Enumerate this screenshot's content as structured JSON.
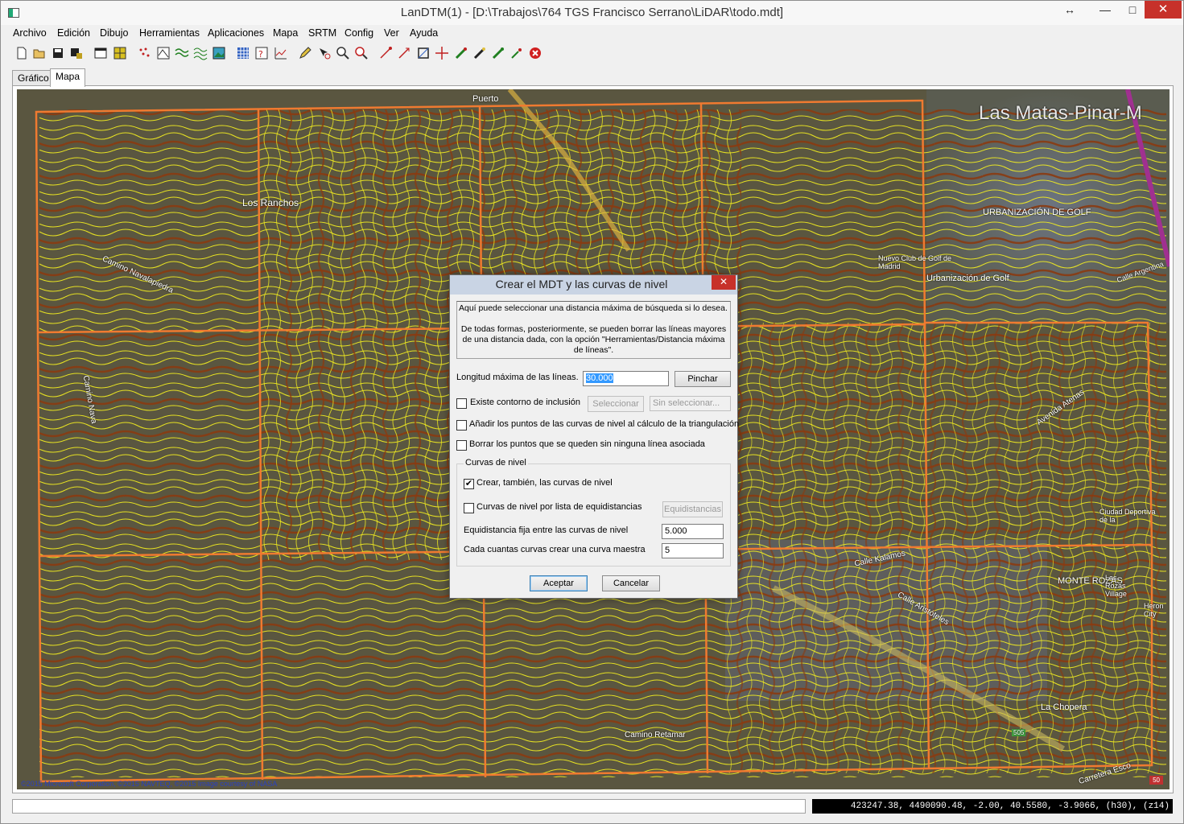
{
  "window": {
    "title": "LanDTM(1) - [D:\\Trabajos\\764 TGS Francisco Serrano\\LiDAR\\todo.mdt]",
    "restore_glyph": "↔",
    "minimize_glyph": "—",
    "maximize_glyph": "□",
    "close_glyph": "✕"
  },
  "menu": [
    "Archivo",
    "Edición",
    "Dibujo",
    "Herramientas",
    "Aplicaciones",
    "Mapa",
    "SRTM",
    "Config",
    "Ver",
    "Ayuda"
  ],
  "toolbar_icons": [
    "new-file-icon",
    "open-folder-icon",
    "save-icon",
    "save-as-icon",
    "window-icon",
    "grid-pattern-icon",
    "scatter-icon",
    "map-tile-icon",
    "contour-icon",
    "contour-alt-icon",
    "image-icon",
    "table-grid-icon",
    "help-grid-icon",
    "profile-icon",
    "pencil-icon",
    "select-icon",
    "zoom-in-icon",
    "zoom-out-icon",
    "arrow-icon",
    "arrow-alt-icon",
    "crop-icon",
    "crosshair-icon",
    "brush-icon",
    "brush-alt-icon",
    "paint-icon",
    "picker-icon",
    "stop-icon"
  ],
  "tabs": [
    "Gráfico",
    "Mapa"
  ],
  "active_tab": "Mapa",
  "map": {
    "labels": {
      "las_matas": "Las Matas-Pinar-M",
      "urbanizacion_golf": "URBANIZACIÓN DE GOLF",
      "nuevo_club": "Nuevo Club de Golf de Madrid",
      "urbanizacion_golf2": "Urbanización de Golf",
      "calle_argentina": "Calle Argentina",
      "los_ranchos": "Los Ranchos",
      "camino_navalapiedra": "Camino Navalapiedra",
      "camino_nava": "Camino Nava",
      "avenida_atenas": "Avenida Atenas",
      "calle_kalamos": "Calle Kalamos",
      "calle_aristoteles": "Calle Aristóteles",
      "monte_rozas": "MONTE ROZAS",
      "las_rozas_village": "Las Rozas Village",
      "ciudad_deportiva": "Ciudad Deportiva de la",
      "camino_retamar": "Camino Retamar",
      "puerto": "Puerto",
      "la_chopera": "La Chopera",
      "road_505": "505",
      "heron_city": "Heron City",
      "carretera": "Carretera Esco"
    },
    "copyright": "©2015 Microsoft Corporation, ©2015 NAVTEQ, ©2015 Image courtesy of NASA",
    "scale_badge": "50"
  },
  "status": {
    "left_text": "",
    "coordinates": "423247.38, 4490090.48, -2.00, 40.5580, -3.9066, (h30), (z14)"
  },
  "dialog": {
    "title": "Crear el MDT y las curvas de nivel",
    "close_glyph": "✕",
    "info_line1": "Aquí puede seleccionar una distancia máxima de búsqueda si lo desea.",
    "info_line2": "De todas formas, posteriormente, se pueden borrar las líneas mayores de una distancia dada, con la opción \"Herramientas/Distancia máxima de líneas\".",
    "max_length_label": "Longitud máxima de las líneas.",
    "max_length_value": "30.000",
    "pinchar_button": "Pinchar",
    "contorno_label": "Existe contorno de inclusión",
    "contorno_checked": false,
    "seleccionar_button": "Seleccionar",
    "sin_seleccionar": "Sin seleccionar...",
    "anadir_label": "Añadir los puntos de las curvas de nivel al cálculo de la triangulación",
    "anadir_checked": false,
    "borrar_label": "Borrar los puntos que se queden sin ninguna línea asociada",
    "borrar_checked": false,
    "group_label": "Curvas de nivel",
    "crear_label": "Crear, también, las curvas de nivel",
    "crear_checked": true,
    "lista_label": "Curvas de nivel por lista de equidistancias",
    "lista_checked": false,
    "equidistancias_button": "Equidistancias",
    "equidistancia_label": "Equidistancia fija entre las curvas de nivel",
    "equidistancia_value": "5.000",
    "maestra_label": "Cada cuantas curvas crear una curva maestra",
    "maestra_value": "5",
    "aceptar_button": "Aceptar",
    "cancelar_button": "Cancelar",
    "check_glyph": "✔"
  },
  "colors": {
    "contour_yellow": "#f5f01e",
    "contour_master": "#8a3a10",
    "tile_border": "#f07a30",
    "terrain_dark": "#4c4a36"
  }
}
